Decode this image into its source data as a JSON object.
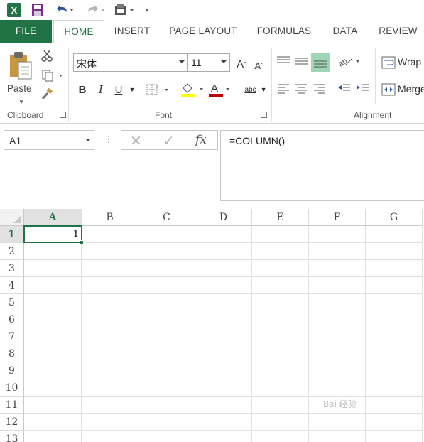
{
  "qat": {
    "app_logo": "X",
    "icons": [
      "excel-logo-icon",
      "save-icon",
      "undo-icon",
      "redo-icon",
      "customize-icon"
    ]
  },
  "tabs": [
    {
      "label": "FILE"
    },
    {
      "label": "HOME"
    },
    {
      "label": "INSERT"
    },
    {
      "label": "PAGE LAYOUT"
    },
    {
      "label": "FORMULAS"
    },
    {
      "label": "DATA"
    },
    {
      "label": "REVIEW"
    }
  ],
  "ribbon": {
    "clipboard": {
      "label": "Clipboard",
      "paste_label": "Paste"
    },
    "font": {
      "label": "Font",
      "font_name": "宋体",
      "font_size": "11",
      "bold": "B",
      "italic": "I",
      "underline": "U",
      "grow": "A",
      "shrink": "A",
      "font_color_letter": "A",
      "abc": "abc"
    },
    "alignment": {
      "label": "Alignment",
      "wrap_label": "Wrap",
      "merge_label": "Merge"
    }
  },
  "formula_bar": {
    "name_box": "A1",
    "cancel_symbol": "✕",
    "enter_symbol": "✓",
    "fx_label": "fx",
    "formula": "=COLUMN()"
  },
  "grid": {
    "columns": [
      "A",
      "B",
      "C",
      "D",
      "E",
      "F",
      "G"
    ],
    "rows": [
      "1",
      "2",
      "3",
      "4",
      "5",
      "6",
      "7",
      "8",
      "9",
      "10",
      "11",
      "12",
      "13"
    ],
    "active_cell": "A1",
    "cells": {
      "A1": "1"
    }
  },
  "colors": {
    "accent": "#217346",
    "font_color_bar": "#c00000",
    "fill_color_bar": "#ffff00"
  },
  "watermark": "Bai 经验"
}
